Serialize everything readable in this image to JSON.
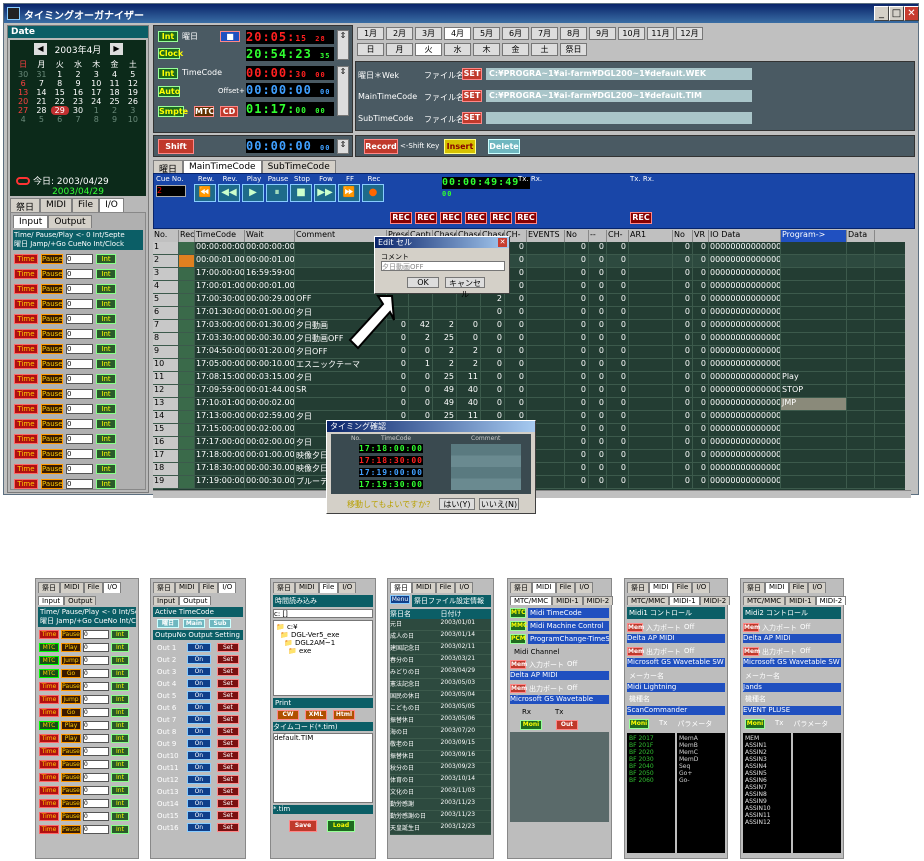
{
  "window": {
    "title": "タイミングオーガナイザー"
  },
  "calendar": {
    "header": "Date",
    "month_title": "2003年4月",
    "weekdays": [
      "日",
      "月",
      "火",
      "水",
      "木",
      "金",
      "土"
    ],
    "rows": [
      [
        "30",
        "31",
        "1",
        "2",
        "3",
        "4",
        "5"
      ],
      [
        "6",
        "7",
        "8",
        "9",
        "10",
        "11",
        "12"
      ],
      [
        "13",
        "14",
        "15",
        "16",
        "17",
        "18",
        "19"
      ],
      [
        "20",
        "21",
        "22",
        "23",
        "24",
        "25",
        "26"
      ],
      [
        "27",
        "28",
        "29",
        "30",
        "1",
        "2",
        "3"
      ],
      [
        "4",
        "5",
        "6",
        "7",
        "8",
        "9",
        "10"
      ]
    ],
    "today_label": "今日: 2003/04/29",
    "selected_date": "2003/04/29"
  },
  "left_tabs": [
    "祭日",
    "MIDI",
    "File",
    "I/O"
  ],
  "io_subtabs": [
    "Input",
    "Output"
  ],
  "io_header_line1": "Time/ Pause/Play  <- 0  Int/Septe",
  "io_header_line2": "曜日   Jamp/+Go CueNo Int/Clock",
  "io_row_labels": {
    "time": "Time",
    "pause": "Pause",
    "spin": "0",
    "int": "Int"
  },
  "time_panel": {
    "int_label": "Int",
    "youbi": "曜日",
    "clock": "Clock",
    "timecode": "TimeCode",
    "auto": "Auto",
    "offset": "Offset+",
    "smpte": "Smpte",
    "mtc": "MTC",
    "cd": "CD",
    "shift": "Shift",
    "time1": "20:05:",
    "time1_s": "15",
    "time1_f": "28",
    "time2": "20:54:23",
    "time2_f": "35",
    "time3": "00:00:",
    "time3_s": "30",
    "time3_f": "00",
    "time4": "00:00:00",
    "time4_f": "00",
    "time5": "01:17:",
    "time5_s": "00",
    "time5_f": "00",
    "time6": "00:00:00",
    "time6_f": "00"
  },
  "month_buttons": [
    "1月",
    "2月",
    "3月",
    "4月",
    "5月",
    "6月",
    "7月",
    "8月",
    "9月",
    "10月",
    "11月",
    "12月"
  ],
  "weekday_buttons": [
    "日",
    "月",
    "火",
    "水",
    "木",
    "金",
    "土",
    "祭日"
  ],
  "files": [
    {
      "label": "曜日＊Wek",
      "file_label": "ファイル名",
      "set": "SET",
      "path": "C:¥PROGRA~1¥ai-farm¥DGL200~1¥default.WEK"
    },
    {
      "label": "MainTimeCode",
      "file_label": "ファイル名",
      "set": "SET",
      "path": "C:¥PROGRA~1¥ai-farm¥DGL200~1¥default.TIM"
    },
    {
      "label": "SubTimeCode",
      "file_label": "ファイル名",
      "set": "SET",
      "path": ""
    }
  ],
  "action_buttons": {
    "record": "Record",
    "shift_key": "<-Shift Key",
    "insert": "Insert",
    "delete": "Delete"
  },
  "main_tabs": [
    "曜日",
    "MainTimeCode",
    "SubTimeCode"
  ],
  "transport": {
    "cue_no": "Cue No.",
    "cue_value": "2",
    "labels": [
      "Rew.",
      "Rev.",
      "Play",
      "Pause",
      "Stop",
      "Fow",
      "FF",
      "Rec"
    ],
    "rec": "REC",
    "tx_rx": "Tx. Rx.",
    "tc_display": "00:00:",
    "tc_s": "49",
    "tc_f": "49",
    "tc_end": "00"
  },
  "table": {
    "columns": [
      "No.",
      "Rec",
      "TimeCode",
      "Wait",
      "Comment",
      "Preset",
      "Captur",
      "Chase1",
      "Chase2",
      "Chase3",
      "CH-",
      "EVENTS",
      "No",
      "--",
      "CH-",
      "AR1",
      "No",
      "VR",
      "IO Data",
      "Program->",
      "Data"
    ],
    "rows": [
      [
        "1",
        "",
        "00:00:00:00",
        "00:00:00:00",
        "",
        "0",
        "1",
        "1",
        "1",
        "1",
        "0",
        "",
        "0",
        "0",
        "0",
        "",
        "0",
        "0",
        "0000000000000000",
        ""
      ],
      [
        "2",
        "",
        "00:00:01.00",
        "00:00:01.00",
        "",
        "0",
        "1",
        "1",
        "1",
        "1",
        "0",
        "",
        "0",
        "0",
        "0",
        "",
        "0",
        "0",
        "0000000000000000",
        ""
      ],
      [
        "3",
        "",
        "17:00:00:00",
        "16:59:59:00",
        "",
        "",
        "",
        "",
        "",
        "2",
        "0",
        "",
        "0",
        "0",
        "0",
        "",
        "0",
        "0",
        "0000000000000000",
        ""
      ],
      [
        "4",
        "",
        "17:00:01:00",
        "00:00:01.00",
        "",
        "",
        "",
        "",
        "",
        "2",
        "0",
        "",
        "0",
        "0",
        "0",
        "",
        "0",
        "0",
        "0000000000000000",
        ""
      ],
      [
        "5",
        "",
        "17:00:30:00",
        "00:00:29.00",
        "OFF",
        "",
        "",
        "",
        "",
        "2",
        "0",
        "",
        "0",
        "0",
        "0",
        "",
        "0",
        "0",
        "0000000000000000",
        ""
      ],
      [
        "6",
        "",
        "17:01:30:00",
        "00:01:00.00",
        "夕日",
        "",
        "",
        "",
        "",
        "0",
        "0",
        "",
        "0",
        "0",
        "0",
        "",
        "0",
        "0",
        "0000000000000000",
        ""
      ],
      [
        "7",
        "",
        "17:03:00:00",
        "00:01:30.00",
        "夕日動画",
        "0",
        "42",
        "2",
        "0",
        "0",
        "0",
        "",
        "0",
        "0",
        "0",
        "",
        "0",
        "0",
        "0000000000000000",
        ""
      ],
      [
        "8",
        "",
        "17:03:30:00",
        "00:00:30.00",
        "夕日動画OFF",
        "0",
        "2",
        "25",
        "0",
        "0",
        "0",
        "",
        "0",
        "0",
        "0",
        "",
        "0",
        "0",
        "0000000000000000",
        ""
      ],
      [
        "9",
        "",
        "17:04:50:00",
        "00:01:20.00",
        "夕日OFF",
        "0",
        "0",
        "2",
        "2",
        "0",
        "0",
        "",
        "0",
        "0",
        "0",
        "",
        "0",
        "0",
        "0000000000000000",
        ""
      ],
      [
        "10",
        "",
        "17:05:00:00",
        "00:00:10.00",
        "エスニックテーマ",
        "0",
        "1",
        "2",
        "2",
        "0",
        "0",
        "",
        "0",
        "0",
        "0",
        "",
        "0",
        "0",
        "0000000000000000",
        ""
      ],
      [
        "11",
        "",
        "17:08:15:00",
        "00:03:15.00",
        "夕日",
        "0",
        "0",
        "25",
        "11",
        "0",
        "0",
        "",
        "0",
        "0",
        "0",
        "",
        "0",
        "0",
        "0000000000000000",
        "Play"
      ],
      [
        "12",
        "",
        "17:09:59:00",
        "00:01:44.00",
        "SR",
        "0",
        "0",
        "49",
        "40",
        "0",
        "0",
        "",
        "0",
        "0",
        "0",
        "",
        "0",
        "0",
        "0000000000000000",
        "STOP"
      ],
      [
        "13",
        "",
        "17:10:01:00",
        "00:00:02.00",
        "",
        "0",
        "0",
        "49",
        "40",
        "0",
        "0",
        "",
        "0",
        "0",
        "0",
        "",
        "0",
        "0",
        "0000000000000000",
        "JMP"
      ],
      [
        "14",
        "",
        "17:13:00:00",
        "00:02:59.00",
        "夕日",
        "0",
        "0",
        "25",
        "11",
        "0",
        "0",
        "",
        "0",
        "0",
        "0",
        "",
        "0",
        "0",
        "0000000000000000",
        ""
      ],
      [
        "15",
        "",
        "17:15:00:00",
        "00:02:00.00",
        "",
        "",
        "",
        "",
        "",
        "0",
        "0",
        "",
        "0",
        "0",
        "0",
        "",
        "0",
        "0",
        "0000000000000000",
        ""
      ],
      [
        "16",
        "",
        "17:17:00:00",
        "00:02:00.00",
        "夕日",
        "",
        "",
        "",
        "",
        "0",
        "0",
        "",
        "0",
        "0",
        "0",
        "",
        "0",
        "0",
        "0000000000000000",
        ""
      ],
      [
        "17",
        "",
        "17:18:00:00",
        "00:01:00.00",
        "映像夕日",
        "",
        "",
        "",
        "",
        "0",
        "0",
        "",
        "0",
        "0",
        "0",
        "",
        "0",
        "0",
        "0000000000000000",
        ""
      ],
      [
        "18",
        "",
        "17:18:30:00",
        "00:00:30.00",
        "映像夕日",
        "",
        "",
        "",
        "",
        "0",
        "0",
        "",
        "0",
        "0",
        "0",
        "",
        "0",
        "0",
        "0000000000000000",
        ""
      ],
      [
        "19",
        "",
        "17:19:00:00",
        "00:00:30.00",
        "ブルーテ",
        "",
        "",
        "",
        "",
        "0",
        "0",
        "",
        "0",
        "0",
        "0",
        "",
        "0",
        "0",
        "0000000000000000",
        ""
      ]
    ]
  },
  "edit_dialog": {
    "title": "Edit セル",
    "label": "コメント",
    "value": "夕日動画OFF",
    "ok": "OK",
    "cancel": "キャンセル"
  },
  "confirm_dialog": {
    "title": "タイミング確認",
    "col_no": "No.",
    "col_tc": "TimeCode",
    "col_comment": "Comment",
    "question": "移動してもよいですか？",
    "yes": "はい(Y)",
    "no": "いいえ(N)",
    "tc1": "17:18:00:00",
    "tc2": "17:18:30:00",
    "tc3": "17:19:00:00",
    "tc4": "17:19:30:00"
  },
  "thumb1": {
    "tabs": [
      "祭日",
      "MIDI",
      "File",
      "I/O"
    ],
    "subtabs": [
      "Input",
      "Output"
    ],
    "hdr1": "Time/ Pause/Play  <- 0  Int/Septe",
    "hdr2": "曜日   Jamp/+Go CueNo Int/Clock",
    "rows": [
      [
        "Time",
        "Pause",
        "0",
        "Int"
      ],
      [
        "MTC",
        "Play",
        "0",
        "Int"
      ],
      [
        "MTC",
        "Jump",
        "0",
        "Int"
      ],
      [
        "MTC",
        "Go",
        "0",
        "Int"
      ],
      [
        "Time",
        "Pause",
        "0",
        "Int"
      ],
      [
        "Time",
        "Jump",
        "0",
        "Int"
      ],
      [
        "Time",
        "Go",
        "0",
        "Int"
      ],
      [
        "MTC",
        "Play",
        "0",
        "Int"
      ],
      [
        "Time",
        "Play",
        "0",
        "Int"
      ],
      [
        "Time",
        "Pause",
        "0",
        "Int"
      ],
      [
        "Time",
        "Pause",
        "0",
        "Int"
      ],
      [
        "Time",
        "Pause",
        "0",
        "Int"
      ],
      [
        "Time",
        "Pause",
        "0",
        "Int"
      ],
      [
        "Time",
        "Pause",
        "0",
        "Int"
      ],
      [
        "Time",
        "Pause",
        "0",
        "Int"
      ],
      [
        "Time",
        "Pause",
        "0",
        "Int"
      ]
    ]
  },
  "thumb2": {
    "tabs": [
      "祭日",
      "MIDI",
      "File",
      "I/O"
    ],
    "subtabs": [
      "Input",
      "Output"
    ],
    "active_tc": "Active TimeCode",
    "tc_btns": [
      "曜日",
      "Main",
      "Sub"
    ],
    "cols": "OutpuNo  Output  Setting",
    "outs": [
      "Out 1",
      "Out 2",
      "Out 3",
      "Out 4",
      "Out 5",
      "Out 6",
      "Out 7",
      "Out 8",
      "Out 9",
      "Out10",
      "Out11",
      "Out12",
      "Out13",
      "Out14",
      "Out15",
      "Out16"
    ],
    "on": "On",
    "set": "Set"
  },
  "thumb3": {
    "tabs": [
      "祭日",
      "MIDI",
      "File",
      "I/O"
    ],
    "hdr": "時間読み込み",
    "drive": "c: []",
    "folders": [
      "c:¥",
      "DGL-Ver5_exe",
      "DGL2AM~1",
      "exe"
    ],
    "print": "Print",
    "btns": [
      "CW",
      "XML",
      "Html"
    ],
    "tc_filter": "タイムコード(*.tim)",
    "file": "default.TIM",
    "ext": "*.tim",
    "save": "Save",
    "load": "Load"
  },
  "thumb4": {
    "tabs": [
      "祭日",
      "MIDI",
      "File",
      "I/O"
    ],
    "btn": "Menu",
    "hdr": "祭日ファイル設定情報",
    "cols": [
      "祭日名",
      "日付け"
    ],
    "rows": [
      [
        "元日",
        "2003/01/01"
      ],
      [
        "成人の日",
        "2003/01/14"
      ],
      [
        "建国記念日",
        "2003/02/11"
      ],
      [
        "春分の日",
        "2003/03/21"
      ],
      [
        "みどりの日",
        "2003/04/29"
      ],
      [
        "憲法記念日",
        "2003/05/03"
      ],
      [
        "国民の休日",
        "2003/05/04"
      ],
      [
        "こどもの日",
        "2003/05/05"
      ],
      [
        "振替休日",
        "2003/05/06"
      ],
      [
        "海の日",
        "2003/07/20"
      ],
      [
        "敬老の日",
        "2003/09/15"
      ],
      [
        "振替休日",
        "2003/09/16"
      ],
      [
        "秋分の日",
        "2003/09/23"
      ],
      [
        "体育の日",
        "2003/10/14"
      ],
      [
        "文化の日",
        "2003/11/03"
      ],
      [
        "勤労感謝",
        "2003/11/23"
      ],
      [
        "勤労感謝の日",
        "2003/11/23"
      ],
      [
        "天皇誕生日",
        "2003/12/23"
      ]
    ]
  },
  "thumb5": {
    "tabs": [
      "祭日",
      "MIDI",
      "File",
      "I/O"
    ],
    "subtabs": [
      "MTC/MMC",
      "MIDI-1",
      "MIDI-2"
    ],
    "rows": [
      [
        "MTC",
        "Midi TimeCode"
      ],
      [
        "MMC",
        "Midi Machine Control"
      ],
      [
        "PCM",
        "ProgramChange-TimeStep"
      ]
    ],
    "channel": "Midi Channel",
    "in": "入力ポート",
    "out": "出力ポート",
    "off": "Off",
    "in_dev": "Delta AP MIDI",
    "out_dev": "Microsoft GS Wavetable",
    "rx": "Rx",
    "tx": "Tx",
    "moni": "Moni",
    "outb": "Out",
    "mem": "Mem"
  },
  "thumb6": {
    "tabs": [
      "祭日",
      "MIDI",
      "File",
      "I/O"
    ],
    "subtabs": [
      "MTC/MMC",
      "MIDI-1",
      "MIDI-2"
    ],
    "hdr": "Midi1 コントロール",
    "mem": "Mem",
    "in": "入力ポート",
    "out": "出力ポート",
    "off": "Off",
    "in_dev": "Delta AP MIDI",
    "out_dev": "Microsoft GS Wavetable SW",
    "maker": "メーカー名",
    "maker_v": "Midi Lightning",
    "model": "機種名",
    "model_v": "ScanCommander",
    "moni": "Moni",
    "tx": "Tx",
    "param": "パラメータ",
    "list": [
      "BF 2017",
      "BF 201F",
      "BF 2020",
      "BF 2030",
      "BF 2040",
      "BF 2050",
      "BF 2060"
    ],
    "list2": [
      "MemA",
      "MemB",
      "MemC",
      "MemD",
      "Seq",
      "Go+",
      "Go-"
    ]
  },
  "thumb7": {
    "tabs": [
      "祭日",
      "MIDI",
      "File",
      "I/O"
    ],
    "subtabs": [
      "MTC/MMC",
      "MIDI-1",
      "MIDI-2"
    ],
    "hdr": "Midi2 コントロール",
    "mem": "Mem",
    "in": "入力ポート",
    "out": "出力ポート",
    "off": "Off",
    "in_dev": "Delta AP MIDI",
    "out_dev": "Microsoft GS Wavetable SW",
    "maker": "メーカー名",
    "maker_v": "Jands",
    "model": "機種名",
    "model_v": "EVENT PLUSE",
    "moni": "Moni",
    "tx": "Tx",
    "param": "パラメータ",
    "list": [
      "MEM",
      "ASSIN1",
      "ASSIN2",
      "ASSIN3",
      "ASSIN4",
      "ASSIN5",
      "ASSIN6",
      "ASSIN7",
      "ASSIN8",
      "ASSIN9",
      "ASSIN10",
      "ASSIN11",
      "ASSIN12"
    ]
  },
  "colors": {
    "teal": "#0b5e66",
    "led_green": "#30ff30",
    "led_red": "#ff2020",
    "grid_bg": "#233d33"
  }
}
